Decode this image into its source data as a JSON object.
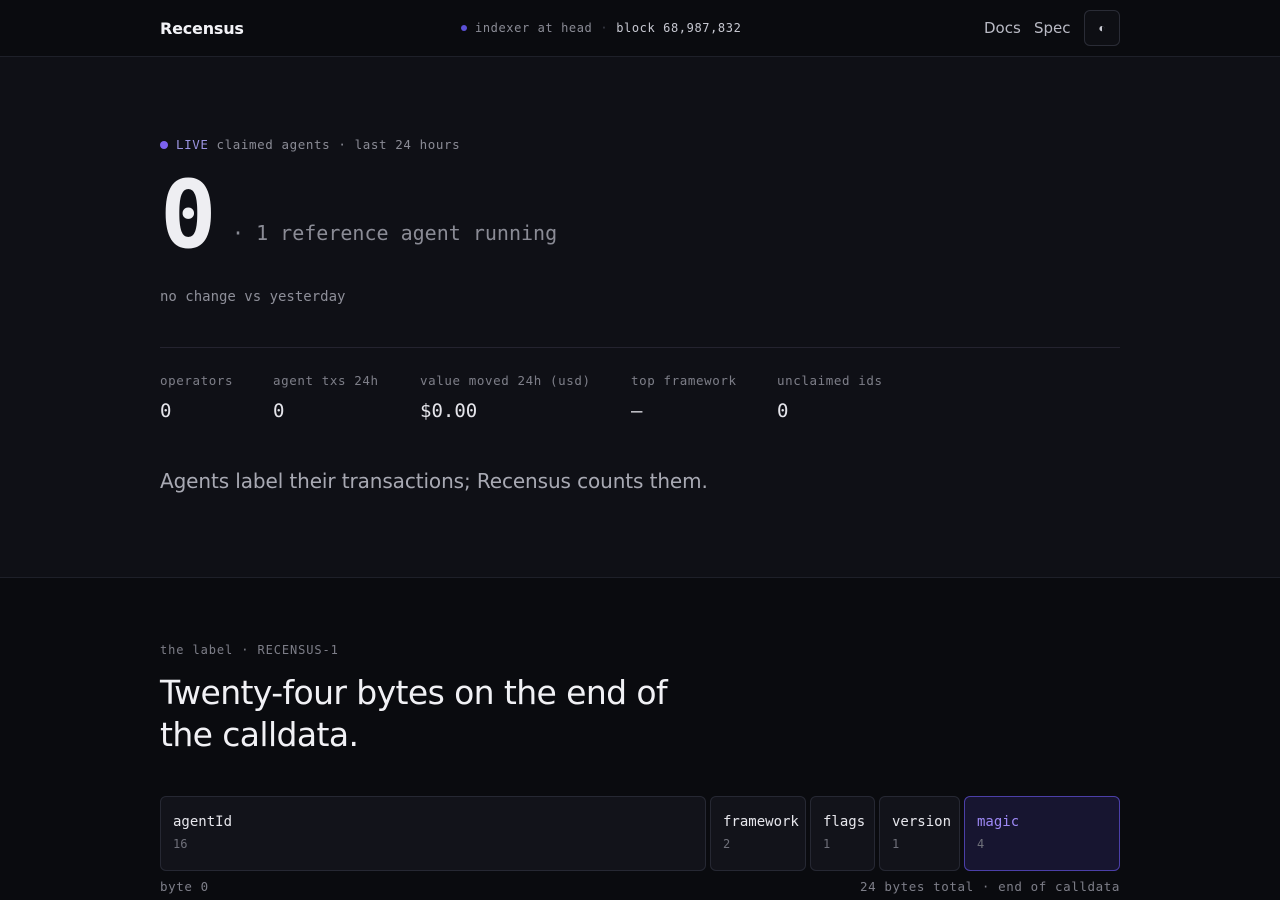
{
  "header": {
    "brand": "Recensus",
    "status_text": "indexer at head",
    "block_text": "block 68,987,832",
    "nav": [
      "Docs",
      "Spec"
    ],
    "theme_toggle_glyph": "◐",
    "status_dot_color": "#5b50d6"
  },
  "hero": {
    "live_badge": "LIVE",
    "live_caption": "claimed agents · last 24 hours",
    "count": "0",
    "reference_text": "· 1 reference agent running",
    "change_text": "no change vs yesterday",
    "stats": [
      {
        "label": "operators",
        "value": "0"
      },
      {
        "label": "agent txs 24h",
        "value": "0"
      },
      {
        "label": "value moved 24h (usd)",
        "value": "$0.00"
      },
      {
        "label": "top framework",
        "value": "—"
      },
      {
        "label": "unclaimed ids",
        "value": "0"
      }
    ],
    "tagline": "Agents label their transactions; Recensus counts them.",
    "accent_color": "#7c62f0"
  },
  "label_section": {
    "eyebrow": "the label · RECENSUS-1",
    "headline": "Twenty-four bytes on the end of the calldata.",
    "fields": [
      {
        "name": "agentId",
        "bytes": "16"
      },
      {
        "name": "framework",
        "bytes": "2"
      },
      {
        "name": "flags",
        "bytes": "1"
      },
      {
        "name": "version",
        "bytes": "1"
      },
      {
        "name": "magic",
        "bytes": "4"
      }
    ],
    "foot_left": "byte 0",
    "foot_right": "24 bytes total · end of calldata",
    "magic_color": "#9d88f5"
  }
}
